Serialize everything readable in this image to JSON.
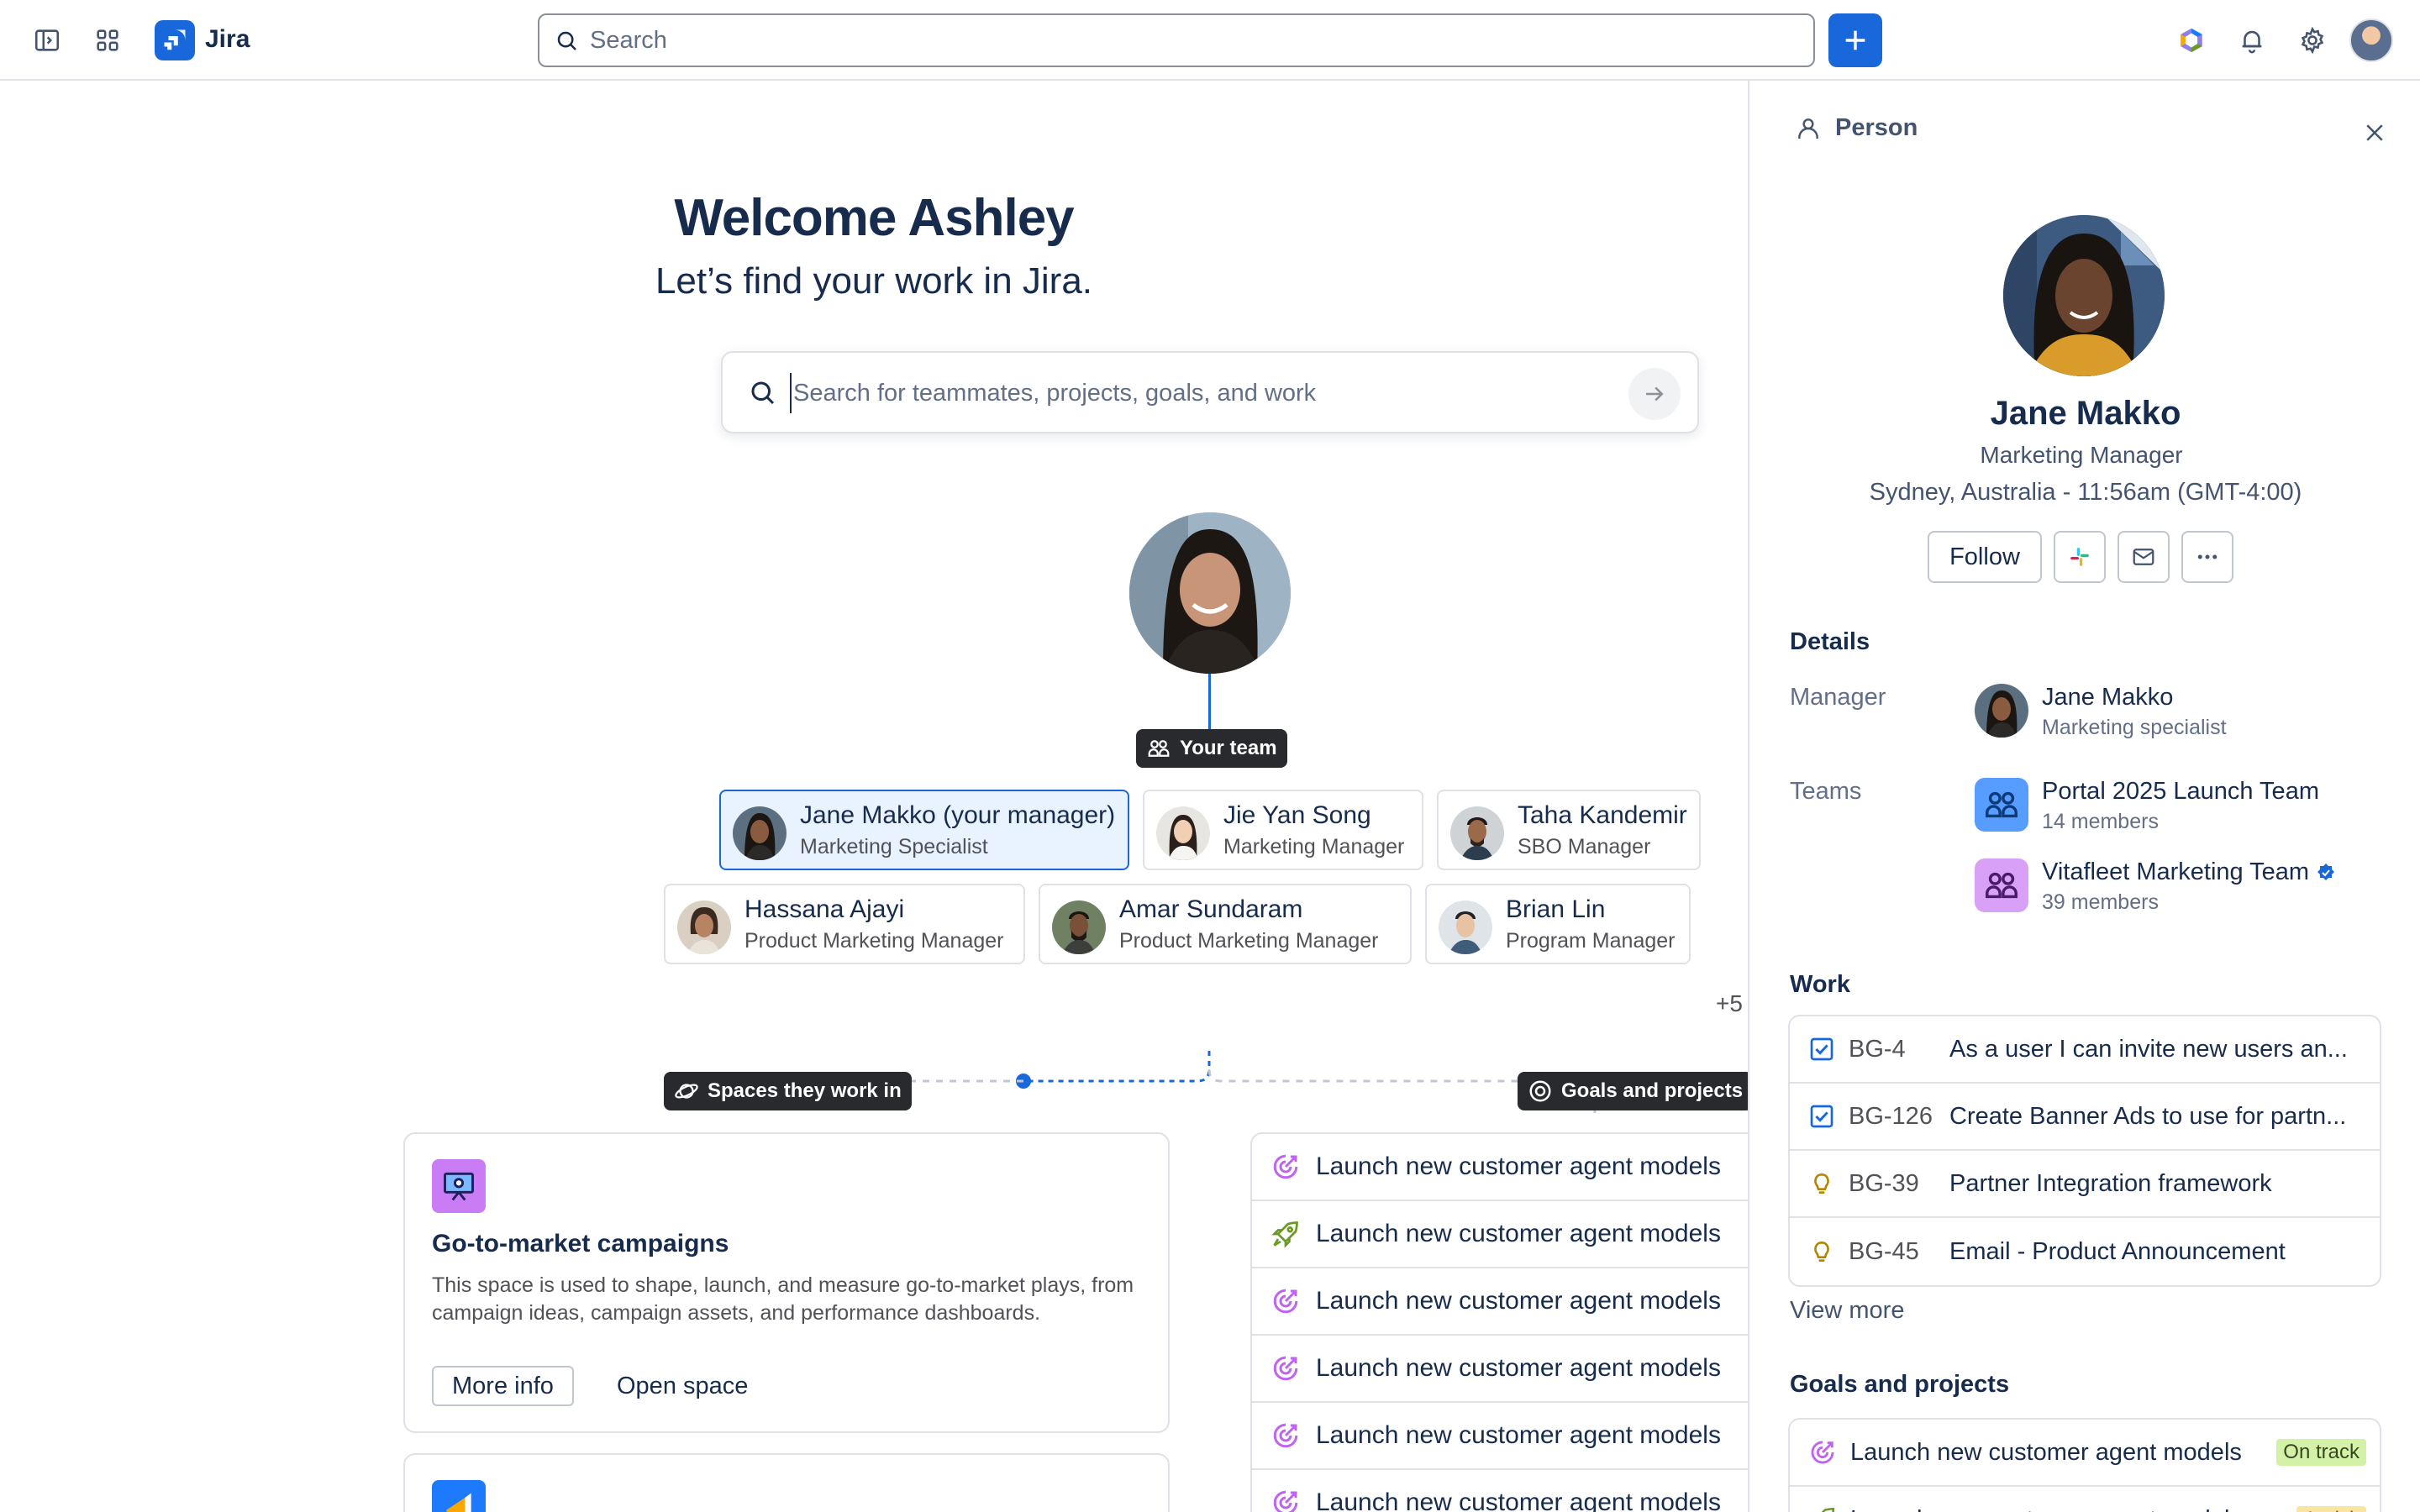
{
  "topbar": {
    "app_name": "Jira",
    "search_placeholder": "Search"
  },
  "welcome": {
    "title": "Welcome Ashley",
    "subtitle": "Let’s find your work in Jira.",
    "search_placeholder": "Search for teammates, projects, goals, and work"
  },
  "team": {
    "tag": "Your team",
    "members": [
      {
        "name": "Jane Makko (your manager)",
        "role": "Marketing Specialist"
      },
      {
        "name": "Jie Yan Song",
        "role": "Marketing Manager"
      },
      {
        "name": "Taha Kandemir",
        "role": "SBO Manager"
      },
      {
        "name": "Hassana Ajayi",
        "role": "Product Marketing Manager"
      },
      {
        "name": "Amar Sundaram",
        "role": "Product Marketing Manager"
      },
      {
        "name": "Brian Lin",
        "role": "Program Manager"
      }
    ],
    "more": "+5"
  },
  "spaces": {
    "tag": "Spaces they work in",
    "cards": [
      {
        "title": "Go-to-market campaigns",
        "description": "This space is used to shape, launch, and measure go-to-market plays, from campaign ideas, campaign assets, and performance dashboards.",
        "more_info": "More info",
        "open": "Open space"
      }
    ]
  },
  "goals": {
    "tag": "Goals and projects",
    "items": [
      {
        "label": "Launch new customer agent models",
        "icon": "goal-icon"
      },
      {
        "label": "Launch new customer agent models",
        "icon": "rocket-icon"
      },
      {
        "label": "Launch new customer agent models",
        "icon": "goal-icon"
      },
      {
        "label": "Launch new customer agent models",
        "icon": "goal-icon"
      },
      {
        "label": "Launch new customer agent models",
        "icon": "goal-icon"
      },
      {
        "label": "Launch new customer agent models",
        "icon": "goal-icon"
      }
    ]
  },
  "panel": {
    "header": "Person",
    "name": "Jane Makko",
    "role": "Marketing Manager",
    "location": "Sydney, Australia - 11:56am (GMT-4:00)",
    "follow": "Follow",
    "details_title": "Details",
    "manager_label": "Manager",
    "manager_name": "Jane Makko",
    "manager_role": "Marketing specialist",
    "teams_label": "Teams",
    "teams": [
      {
        "name": "Portal 2025 Launch Team",
        "members": "14 members",
        "color": "#579dff",
        "verified": false
      },
      {
        "name": "Vitafleet Marketing Team",
        "members": "39 members",
        "color": "#d8a0f7",
        "verified": true
      }
    ],
    "work_title": "Work",
    "work": [
      {
        "key": "BG-4",
        "title": "As a user I can invite new users an...",
        "type": "story"
      },
      {
        "key": "BG-126",
        "title": "Create Banner Ads to use for partn...",
        "type": "story"
      },
      {
        "key": "BG-39",
        "title": "Partner Integration framework",
        "type": "idea"
      },
      {
        "key": "BG-45",
        "title": "Email - Product Announcement",
        "type": "idea"
      }
    ],
    "view_more": "View more",
    "goals_title": "Goals and projects",
    "goals": [
      {
        "label": "Launch new customer agent models",
        "status": "On track"
      },
      {
        "label": "Launch new customer agent models",
        "status": "At risk"
      }
    ]
  },
  "colors": {
    "brand_blue": "#1868db",
    "tag_dark": "#292a2e",
    "selected_bg": "#e9f2ff",
    "goal_purple": "#bf63f3",
    "rocket_green": "#6a9a23",
    "idea_yellow": "#b38600"
  }
}
